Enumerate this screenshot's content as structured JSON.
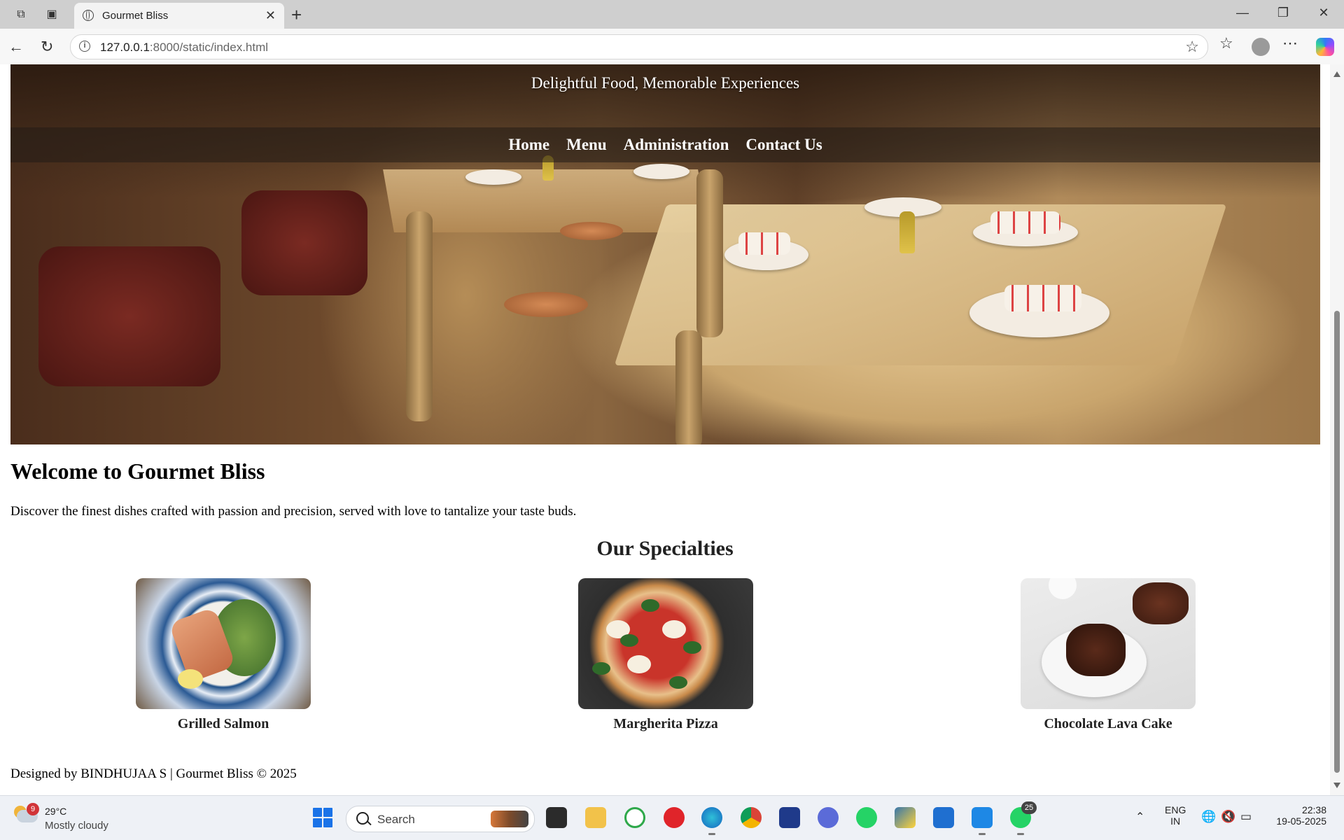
{
  "browser": {
    "tab_title": "Gourmet Bliss",
    "url_host": "127.0.0.1",
    "url_path": ":8000/static/index.html"
  },
  "site": {
    "tagline": "Delightful Food, Memorable Experiences",
    "nav": [
      "Home",
      "Menu",
      "Administration",
      "Contact Us"
    ],
    "welcome_title": "Welcome to Gourmet Bliss",
    "intro": "Discover the finest dishes crafted with passion and precision, served with love to tantalize your taste buds.",
    "specialties_title": "Our Specialties",
    "dishes": [
      "Grilled Salmon",
      "Margherita Pizza",
      "Chocolate Lava Cake"
    ],
    "footer": "Designed by BINDHUJAA S | Gourmet Bliss © 2025"
  },
  "taskbar": {
    "weather_temp": "29°C",
    "weather_condition": "Mostly cloudy",
    "weather_badge": "9",
    "search_label": "Search",
    "whatsapp_badge": "25",
    "language_line1": "ENG",
    "language_line2": "IN",
    "time": "22:38",
    "date": "19-05-2025"
  }
}
